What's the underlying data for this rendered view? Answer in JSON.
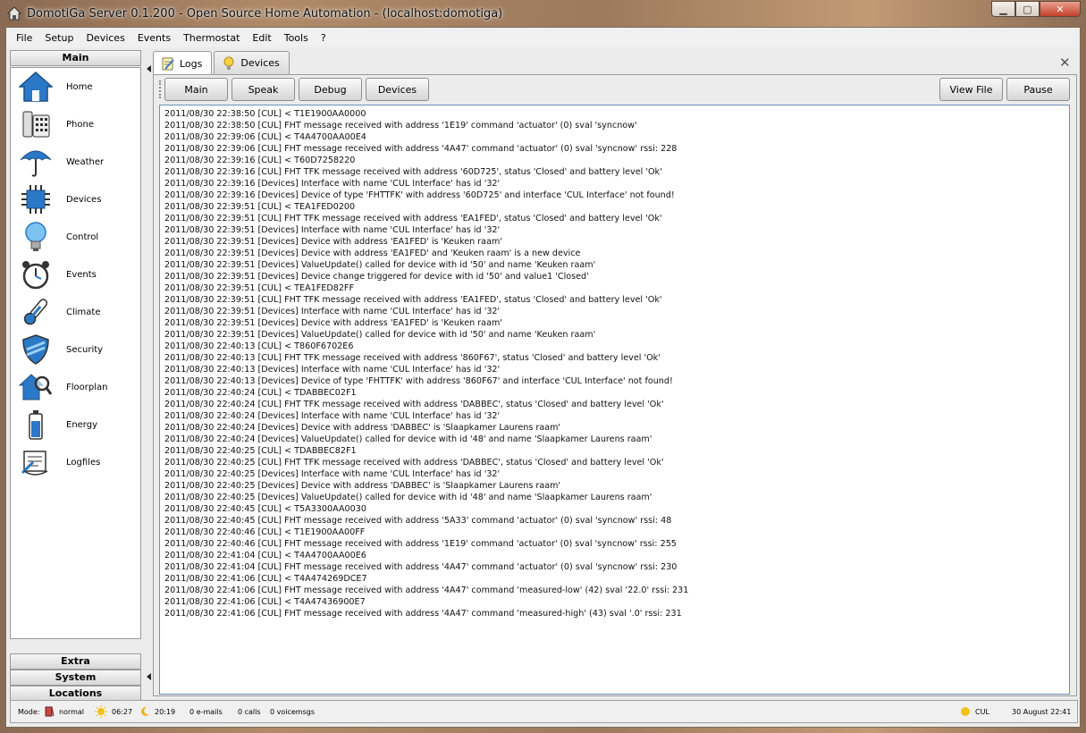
{
  "window": {
    "title": "DomotiGa Server 0.1.200 - Open Source Home Automation - (localhost:domotiga)",
    "controls": {
      "minimize": "▁",
      "maximize": "▢",
      "close": "✕"
    }
  },
  "menu": [
    "File",
    "Setup",
    "Devices",
    "Events",
    "Thermostat",
    "Edit",
    "Tools",
    "?"
  ],
  "sidebar": {
    "header": "Main",
    "items": [
      {
        "label": "Home",
        "icon": "home-icon"
      },
      {
        "label": "Phone",
        "icon": "phone-icon"
      },
      {
        "label": "Weather",
        "icon": "umbrella-icon"
      },
      {
        "label": "Devices",
        "icon": "chip-icon"
      },
      {
        "label": "Control",
        "icon": "lightbulb-icon"
      },
      {
        "label": "Events",
        "icon": "alarm-clock-icon"
      },
      {
        "label": "Climate",
        "icon": "thermometer-icon"
      },
      {
        "label": "Security",
        "icon": "shield-icon"
      },
      {
        "label": "Floorplan",
        "icon": "house-magnifier-icon"
      },
      {
        "label": "Energy",
        "icon": "battery-icon"
      },
      {
        "label": "Logfiles",
        "icon": "scroll-icon"
      }
    ],
    "sections": [
      "Extra",
      "System",
      "Locations"
    ]
  },
  "tabs": [
    {
      "label": "Logs",
      "icon": "notepad-icon",
      "active": true
    },
    {
      "label": "Devices",
      "icon": "lightbulb-icon",
      "active": false
    }
  ],
  "close_glyph": "✕",
  "toolbar": {
    "buttons": [
      "Main",
      "Speak",
      "Debug",
      "Devices"
    ],
    "right_buttons": [
      "View File",
      "Pause"
    ]
  },
  "log_lines": [
    "2011/08/30 22:38:50 [CUL] < T1E1900AA0000",
    "2011/08/30 22:38:50 [CUL] FHT message received with address '1E19' command 'actuator' (0) sval 'syncnow'",
    "2011/08/30 22:39:06 [CUL] < T4A4700AA00E4",
    "2011/08/30 22:39:06 [CUL] FHT message received with address '4A47' command 'actuator' (0) sval 'syncnow' rssi: 228",
    "2011/08/30 22:39:16 [CUL] < T60D7258220",
    "2011/08/30 22:39:16 [CUL] FHT TFK message received with address '60D725', status 'Closed' and battery level 'Ok'",
    "2011/08/30 22:39:16 [Devices] Interface with name 'CUL Interface' has id '32'",
    "2011/08/30 22:39:16 [Devices] Device of type 'FHTTFK' with address '60D725' and interface 'CUL Interface' not found!",
    "2011/08/30 22:39:51 [CUL] < TEA1FED0200",
    "2011/08/30 22:39:51 [CUL] FHT TFK message received with address 'EA1FED', status 'Closed' and battery level 'Ok'",
    "2011/08/30 22:39:51 [Devices] Interface with name 'CUL Interface' has id '32'",
    "2011/08/30 22:39:51 [Devices] Device with address 'EA1FED' is 'Keuken raam'",
    "2011/08/30 22:39:51 [Devices] Device with address 'EA1FED' and 'Keuken raam' is a new device",
    "2011/08/30 22:39:51 [Devices] ValueUpdate() called for device with id '50' and name 'Keuken raam'",
    "2011/08/30 22:39:51 [Devices] Device change triggered for device with id '50' and value1 'Closed'",
    "2011/08/30 22:39:51 [CUL] < TEA1FED82FF",
    "2011/08/30 22:39:51 [CUL] FHT TFK message received with address 'EA1FED', status 'Closed' and battery level 'Ok'",
    "2011/08/30 22:39:51 [Devices] Interface with name 'CUL Interface' has id '32'",
    "2011/08/30 22:39:51 [Devices] Device with address 'EA1FED' is 'Keuken raam'",
    "2011/08/30 22:39:51 [Devices] ValueUpdate() called for device with id '50' and name 'Keuken raam'",
    "2011/08/30 22:40:13 [CUL] < T860F6702E6",
    "2011/08/30 22:40:13 [CUL] FHT TFK message received with address '860F67', status 'Closed' and battery level 'Ok'",
    "2011/08/30 22:40:13 [Devices] Interface with name 'CUL Interface' has id '32'",
    "2011/08/30 22:40:13 [Devices] Device of type 'FHTTFK' with address '860F67' and interface 'CUL Interface' not found!",
    "2011/08/30 22:40:24 [CUL] < TDABBEC02F1",
    "2011/08/30 22:40:24 [CUL] FHT TFK message received with address 'DABBEC', status 'Closed' and battery level 'Ok'",
    "2011/08/30 22:40:24 [Devices] Interface with name 'CUL Interface' has id '32'",
    "2011/08/30 22:40:24 [Devices] Device with address 'DABBEC' is 'Slaapkamer Laurens raam'",
    "2011/08/30 22:40:24 [Devices] ValueUpdate() called for device with id '48' and name 'Slaapkamer Laurens raam'",
    "2011/08/30 22:40:25 [CUL] < TDABBEC82F1",
    "2011/08/30 22:40:25 [CUL] FHT TFK message received with address 'DABBEC', status 'Closed' and battery level 'Ok'",
    "2011/08/30 22:40:25 [Devices] Interface with name 'CUL Interface' has id '32'",
    "2011/08/30 22:40:25 [Devices] Device with address 'DABBEC' is 'Slaapkamer Laurens raam'",
    "2011/08/30 22:40:25 [Devices] ValueUpdate() called for device with id '48' and name 'Slaapkamer Laurens raam'",
    "2011/08/30 22:40:45 [CUL] < T5A3300AA0030",
    "2011/08/30 22:40:45 [CUL] FHT message received with address '5A33' command 'actuator' (0) sval 'syncnow' rssi: 48",
    "2011/08/30 22:40:46 [CUL] < T1E1900AA00FF",
    "2011/08/30 22:40:46 [CUL] FHT message received with address '1E19' command 'actuator' (0) sval 'syncnow' rssi: 255",
    "2011/08/30 22:41:04 [CUL] < T4A4700AA00E6",
    "2011/08/30 22:41:04 [CUL] FHT message received with address '4A47' command 'actuator' (0) sval 'syncnow' rssi: 230",
    "2011/08/30 22:41:06 [CUL] < T4A474269DCE7",
    "2011/08/30 22:41:06 [CUL] FHT message received with address '4A47' command 'measured-low' (42) sval '22.0' rssi: 231",
    "2011/08/30 22:41:06 [CUL] < T4A47436900E7",
    "2011/08/30 22:41:06 [CUL] FHT message received with address '4A47' command 'measured-high' (43) sval '.0' rssi: 231"
  ],
  "status": {
    "mode_label": "Mode:",
    "mode_value": "normal",
    "sunrise": "06:27",
    "sunset": "20:19",
    "emails": "0 e-mails",
    "calls": "0 calls",
    "voicemsgs": "0 voicemsgs",
    "interface": "CUL",
    "datetime": "30 August 22:41"
  },
  "colors": {
    "accent_blue": "#2b78c6",
    "log_border": "#6f8fb8",
    "close_red": "#c4412a"
  }
}
